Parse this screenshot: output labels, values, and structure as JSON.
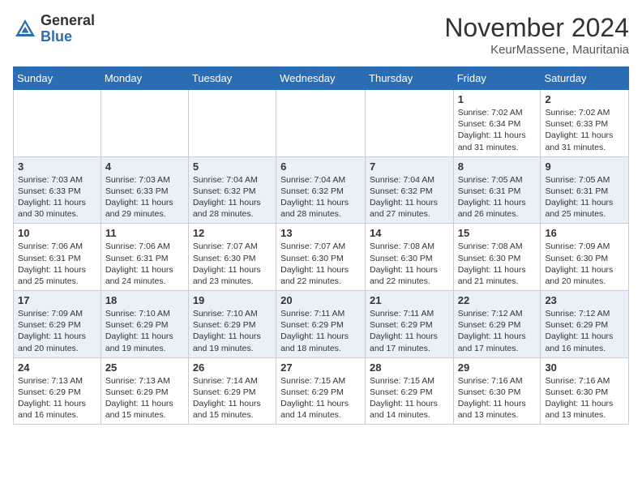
{
  "header": {
    "logo_general": "General",
    "logo_blue": "Blue",
    "month_title": "November 2024",
    "location": "KeurMassene, Mauritania"
  },
  "weekdays": [
    "Sunday",
    "Monday",
    "Tuesday",
    "Wednesday",
    "Thursday",
    "Friday",
    "Saturday"
  ],
  "weeks": [
    [
      {
        "day": "",
        "info": ""
      },
      {
        "day": "",
        "info": ""
      },
      {
        "day": "",
        "info": ""
      },
      {
        "day": "",
        "info": ""
      },
      {
        "day": "",
        "info": ""
      },
      {
        "day": "1",
        "info": "Sunrise: 7:02 AM\nSunset: 6:34 PM\nDaylight: 11 hours and 31 minutes."
      },
      {
        "day": "2",
        "info": "Sunrise: 7:02 AM\nSunset: 6:33 PM\nDaylight: 11 hours and 31 minutes."
      }
    ],
    [
      {
        "day": "3",
        "info": "Sunrise: 7:03 AM\nSunset: 6:33 PM\nDaylight: 11 hours and 30 minutes."
      },
      {
        "day": "4",
        "info": "Sunrise: 7:03 AM\nSunset: 6:33 PM\nDaylight: 11 hours and 29 minutes."
      },
      {
        "day": "5",
        "info": "Sunrise: 7:04 AM\nSunset: 6:32 PM\nDaylight: 11 hours and 28 minutes."
      },
      {
        "day": "6",
        "info": "Sunrise: 7:04 AM\nSunset: 6:32 PM\nDaylight: 11 hours and 28 minutes."
      },
      {
        "day": "7",
        "info": "Sunrise: 7:04 AM\nSunset: 6:32 PM\nDaylight: 11 hours and 27 minutes."
      },
      {
        "day": "8",
        "info": "Sunrise: 7:05 AM\nSunset: 6:31 PM\nDaylight: 11 hours and 26 minutes."
      },
      {
        "day": "9",
        "info": "Sunrise: 7:05 AM\nSunset: 6:31 PM\nDaylight: 11 hours and 25 minutes."
      }
    ],
    [
      {
        "day": "10",
        "info": "Sunrise: 7:06 AM\nSunset: 6:31 PM\nDaylight: 11 hours and 25 minutes."
      },
      {
        "day": "11",
        "info": "Sunrise: 7:06 AM\nSunset: 6:31 PM\nDaylight: 11 hours and 24 minutes."
      },
      {
        "day": "12",
        "info": "Sunrise: 7:07 AM\nSunset: 6:30 PM\nDaylight: 11 hours and 23 minutes."
      },
      {
        "day": "13",
        "info": "Sunrise: 7:07 AM\nSunset: 6:30 PM\nDaylight: 11 hours and 22 minutes."
      },
      {
        "day": "14",
        "info": "Sunrise: 7:08 AM\nSunset: 6:30 PM\nDaylight: 11 hours and 22 minutes."
      },
      {
        "day": "15",
        "info": "Sunrise: 7:08 AM\nSunset: 6:30 PM\nDaylight: 11 hours and 21 minutes."
      },
      {
        "day": "16",
        "info": "Sunrise: 7:09 AM\nSunset: 6:30 PM\nDaylight: 11 hours and 20 minutes."
      }
    ],
    [
      {
        "day": "17",
        "info": "Sunrise: 7:09 AM\nSunset: 6:29 PM\nDaylight: 11 hours and 20 minutes."
      },
      {
        "day": "18",
        "info": "Sunrise: 7:10 AM\nSunset: 6:29 PM\nDaylight: 11 hours and 19 minutes."
      },
      {
        "day": "19",
        "info": "Sunrise: 7:10 AM\nSunset: 6:29 PM\nDaylight: 11 hours and 19 minutes."
      },
      {
        "day": "20",
        "info": "Sunrise: 7:11 AM\nSunset: 6:29 PM\nDaylight: 11 hours and 18 minutes."
      },
      {
        "day": "21",
        "info": "Sunrise: 7:11 AM\nSunset: 6:29 PM\nDaylight: 11 hours and 17 minutes."
      },
      {
        "day": "22",
        "info": "Sunrise: 7:12 AM\nSunset: 6:29 PM\nDaylight: 11 hours and 17 minutes."
      },
      {
        "day": "23",
        "info": "Sunrise: 7:12 AM\nSunset: 6:29 PM\nDaylight: 11 hours and 16 minutes."
      }
    ],
    [
      {
        "day": "24",
        "info": "Sunrise: 7:13 AM\nSunset: 6:29 PM\nDaylight: 11 hours and 16 minutes."
      },
      {
        "day": "25",
        "info": "Sunrise: 7:13 AM\nSunset: 6:29 PM\nDaylight: 11 hours and 15 minutes."
      },
      {
        "day": "26",
        "info": "Sunrise: 7:14 AM\nSunset: 6:29 PM\nDaylight: 11 hours and 15 minutes."
      },
      {
        "day": "27",
        "info": "Sunrise: 7:15 AM\nSunset: 6:29 PM\nDaylight: 11 hours and 14 minutes."
      },
      {
        "day": "28",
        "info": "Sunrise: 7:15 AM\nSunset: 6:29 PM\nDaylight: 11 hours and 14 minutes."
      },
      {
        "day": "29",
        "info": "Sunrise: 7:16 AM\nSunset: 6:30 PM\nDaylight: 11 hours and 13 minutes."
      },
      {
        "day": "30",
        "info": "Sunrise: 7:16 AM\nSunset: 6:30 PM\nDaylight: 11 hours and 13 minutes."
      }
    ]
  ]
}
